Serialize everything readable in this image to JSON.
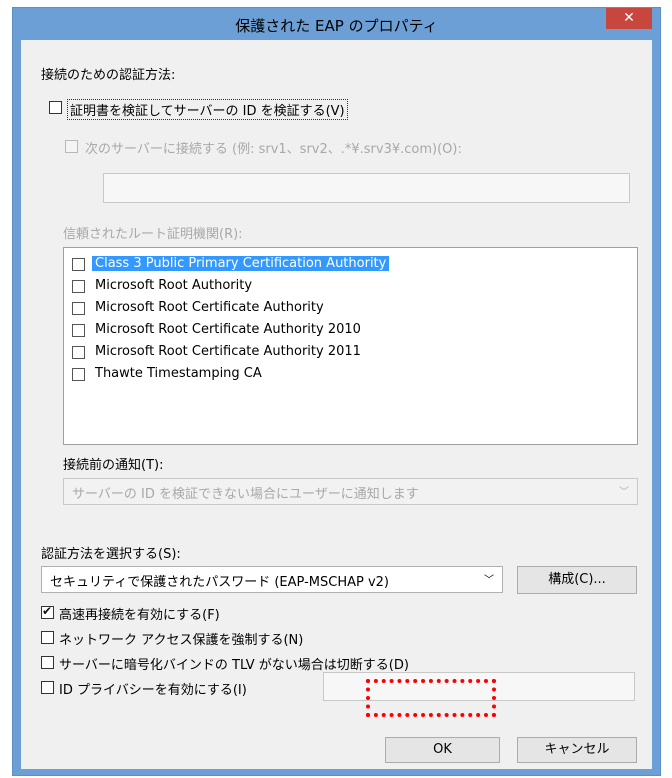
{
  "window": {
    "title": "保護された EAP のプロパティ",
    "close_symbol": "✕"
  },
  "connection_auth": {
    "heading": "接続のための認証方法:",
    "verify_cert": {
      "label": "証明書を検証してサーバーの ID を検証する(V)",
      "checked": false
    },
    "connect_servers": {
      "label": "次のサーバーに接続する (例: srv1、srv2、.*¥.srv3¥.com)(O):",
      "checked": false,
      "value": ""
    },
    "trusted_roots_label": "信頼されたルート証明機関(R):",
    "trusted_roots": [
      {
        "name": "Class 3 Public Primary Certification Authority",
        "checked": false,
        "selected": true
      },
      {
        "name": "Microsoft Root Authority",
        "checked": false,
        "selected": false
      },
      {
        "name": "Microsoft Root Certificate Authority",
        "checked": false,
        "selected": false
      },
      {
        "name": "Microsoft Root Certificate Authority 2010",
        "checked": false,
        "selected": false
      },
      {
        "name": "Microsoft Root Certificate Authority 2011",
        "checked": false,
        "selected": false
      },
      {
        "name": "Thawte Timestamping CA",
        "checked": false,
        "selected": false
      }
    ],
    "notify_label": "接続前の通知(T):",
    "notify_value": "サーバーの ID を検証できない場合にユーザーに通知します"
  },
  "auth_method": {
    "label": "認証方法を選択する(S):",
    "value": "セキュリティで保護されたパスワード (EAP-MSCHAP v2)",
    "configure_label": "構成(C)..."
  },
  "options": {
    "fast_reconnect": {
      "label": "高速再接続を有効にする(F)",
      "checked": true
    },
    "nap": {
      "label": "ネットワーク アクセス保護を強制する(N)",
      "checked": false
    },
    "crypto_binding": {
      "label": "サーバーに暗号化バインドの TLV がない場合は切断する(D)",
      "checked": false
    },
    "identity_privacy": {
      "label": "ID プライバシーを有効にする(I)",
      "checked": false,
      "value": ""
    }
  },
  "buttons": {
    "ok": "OK",
    "cancel": "キャンセル"
  },
  "colors": {
    "title_bar": "#6b9fd6",
    "close_button": "#c7463e",
    "selection": "#3399ff",
    "highlight_border": "#ff0000"
  }
}
